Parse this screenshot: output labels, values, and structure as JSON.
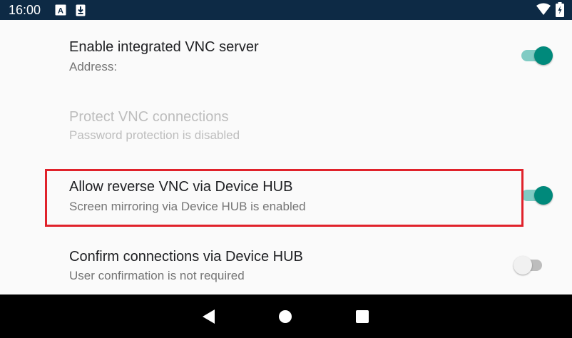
{
  "status_bar": {
    "time": "16:00",
    "icons": [
      "keyboard-a-icon",
      "download-icon",
      "wifi-icon",
      "battery-charging-icon"
    ]
  },
  "settings": {
    "items": [
      {
        "title": "Enable integrated VNC server",
        "summary": "Address:",
        "enabled": true,
        "switch_on": true
      },
      {
        "title": "Protect VNC connections",
        "summary": "Password protection is disabled",
        "enabled": false
      },
      {
        "title": "Allow reverse VNC via Device HUB",
        "summary": "Screen mirroring via Device HUB is enabled",
        "enabled": true,
        "switch_on": true,
        "highlighted": true
      },
      {
        "title": "Confirm connections via Device HUB",
        "summary": "User confirmation is not required",
        "enabled": true,
        "switch_on": false
      }
    ]
  },
  "nav_bar": {
    "buttons": [
      "back-icon",
      "home-icon",
      "recents-icon"
    ]
  },
  "colors": {
    "status_bar_bg": "#0d2a45",
    "accent": "#00897b",
    "highlight_border": "#e0222b",
    "nav_bar_bg": "#000000"
  }
}
